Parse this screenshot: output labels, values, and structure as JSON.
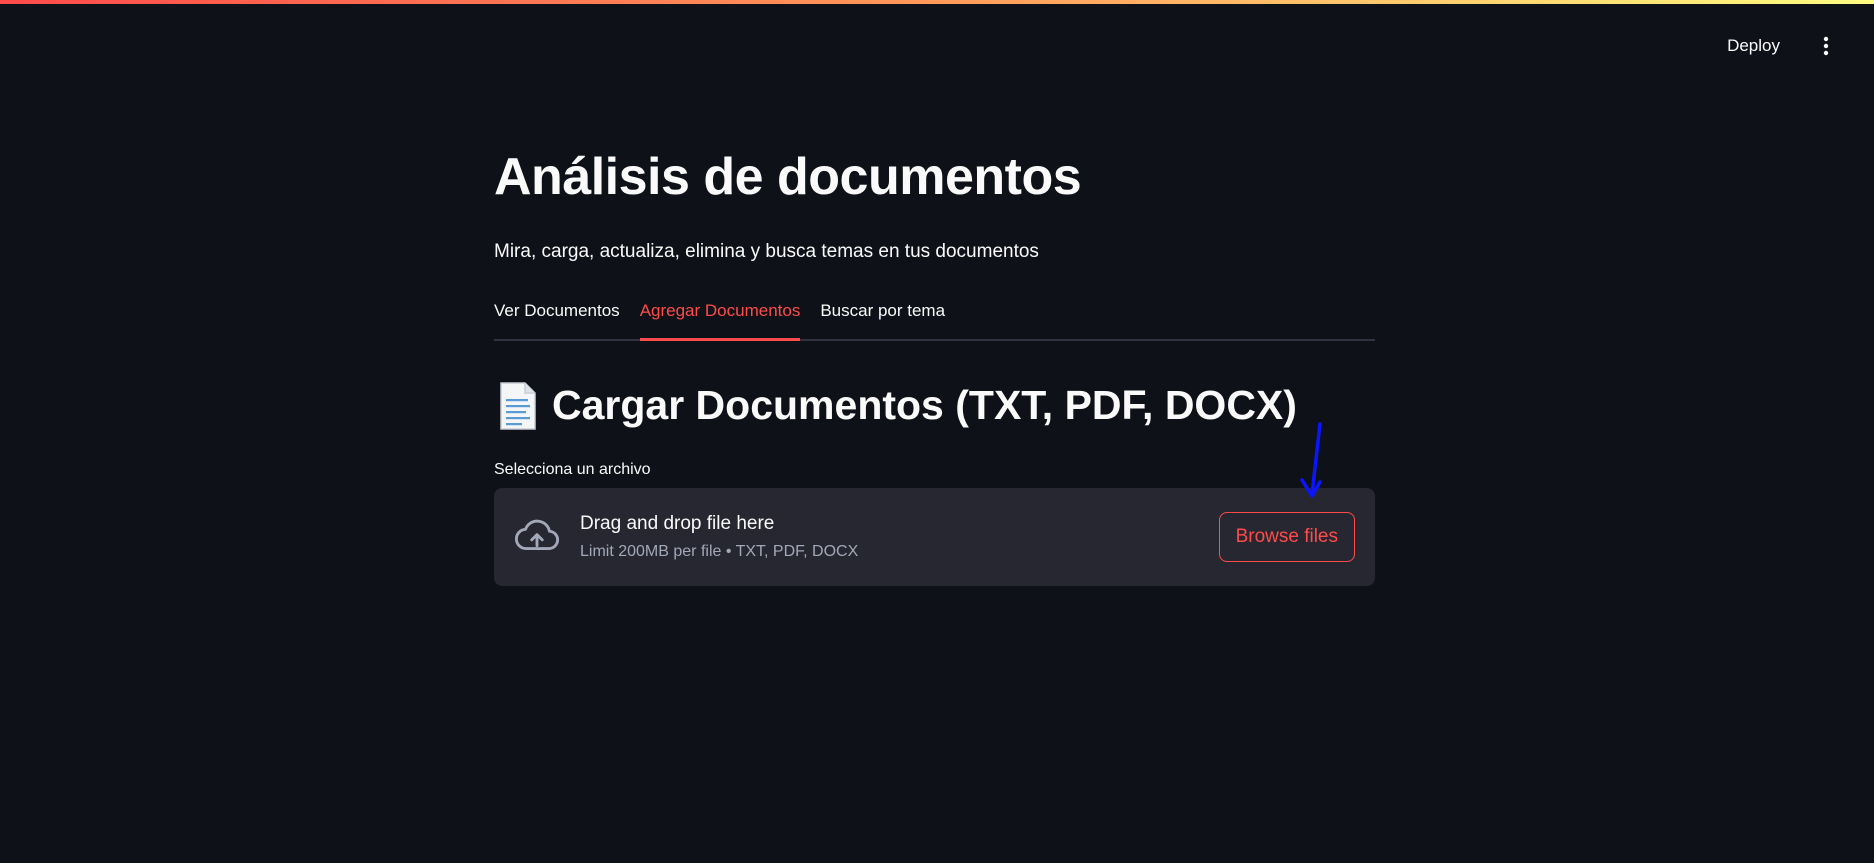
{
  "header": {
    "deploy_label": "Deploy"
  },
  "page": {
    "title": "Análisis de documentos",
    "subtitle": "Mira, carga, actualiza, elimina y busca temas en tus documentos"
  },
  "tabs": [
    {
      "label": "Ver Documentos",
      "active": false
    },
    {
      "label": "Agregar Documentos",
      "active": true
    },
    {
      "label": "Buscar por tema",
      "active": false
    }
  ],
  "section": {
    "icon": "document-icon",
    "title": "Cargar Documentos (TXT, PDF, DOCX)"
  },
  "uploader": {
    "label": "Selecciona un archivo",
    "icon": "cloud-upload-icon",
    "drop_text": "Drag and drop file here",
    "limit_text": "Limit 200MB per file • TXT, PDF, DOCX",
    "browse_label": "Browse files"
  },
  "colors": {
    "accent": "#ff4b4b",
    "background": "#0e1117",
    "dropzone": "#262730",
    "annotation": "#0b16ff"
  }
}
